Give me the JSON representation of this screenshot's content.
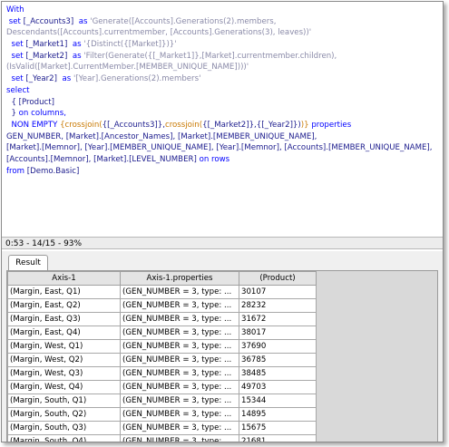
{
  "editor": {
    "lines": [
      [
        {
          "t": "With",
          "c": "kw"
        }
      ],
      [
        {
          "t": " set ",
          "c": "kw"
        },
        {
          "t": "[_Accounts3]",
          "c": "id"
        },
        {
          "t": "  as ",
          "c": "kw"
        },
        {
          "t": "'Generate([Accounts].Generations(2).members,",
          "c": "str"
        }
      ],
      [
        {
          "t": "Descendants([Accounts].currentmember, [Accounts].Generations(3), leaves))'",
          "c": "str"
        }
      ],
      [
        {
          "t": "  set ",
          "c": "kw"
        },
        {
          "t": "[_Market1]",
          "c": "id"
        },
        {
          "t": "  as ",
          "c": "kw"
        },
        {
          "t": "'{Distinct({[Market]})}'",
          "c": "str"
        }
      ],
      [
        {
          "t": "  set ",
          "c": "kw"
        },
        {
          "t": "[_Market2]",
          "c": "id"
        },
        {
          "t": "  as ",
          "c": "kw"
        },
        {
          "t": "'Filter(Generate({[_Market1]},[Market].currentmember.children),",
          "c": "str"
        }
      ],
      [
        {
          "t": "(IsValid([Market].CurrentMember.[MEMBER_UNIQUE_NAME])))'",
          "c": "str"
        }
      ],
      [
        {
          "t": "  set ",
          "c": "kw"
        },
        {
          "t": "[_Year2]",
          "c": "id"
        },
        {
          "t": "  as ",
          "c": "kw"
        },
        {
          "t": "'[Year].Generations(2).members'",
          "c": "str"
        }
      ],
      [
        {
          "t": "select",
          "c": "kw"
        }
      ],
      [
        {
          "t": "  { [Product]",
          "c": "id"
        }
      ],
      [
        {
          "t": "  } ",
          "c": "id"
        },
        {
          "t": "on columns,",
          "c": "kw"
        }
      ],
      [
        {
          "t": "  NON EMPTY ",
          "c": "kw"
        },
        {
          "t": "{crossjoin(",
          "c": "fn"
        },
        {
          "t": "{[_Accounts3]},",
          "c": "id"
        },
        {
          "t": "crossjoin(",
          "c": "fn"
        },
        {
          "t": "{[_Market2]},{[_Year2]})",
          "c": "id"
        },
        {
          "t": ")} ",
          "c": "fn"
        },
        {
          "t": "properties",
          "c": "kw"
        }
      ],
      [
        {
          "t": "GEN_NUMBER, [Market].[Ancestor_Names], [Market].[MEMBER_UNIQUE_NAME],",
          "c": "id"
        }
      ],
      [
        {
          "t": "[Market].[Memnor], [Year].[MEMBER_UNIQUE_NAME], [Year].[Memnor], [Accounts].[MEMBER_UNIQUE_NAME],",
          "c": "id"
        }
      ],
      [
        {
          "t": "[Accounts].[Memnor], [Market].[LEVEL_NUMBER] ",
          "c": "id"
        },
        {
          "t": "on rows",
          "c": "kw"
        }
      ],
      [
        {
          "t": "from ",
          "c": "kw"
        },
        {
          "t": "[Demo.Basic]",
          "c": "id"
        }
      ]
    ]
  },
  "status": {
    "text": "0:53 - 14/15 - 93%"
  },
  "tabs": {
    "result_label": "Result"
  },
  "grid": {
    "headers": [
      "Axis-1",
      "Axis-1.properties",
      "(Product)"
    ],
    "rows": [
      [
        "(Margin, East, Q1)",
        "(GEN_NUMBER = 3, type: ...",
        "30107"
      ],
      [
        "(Margin, East, Q2)",
        "(GEN_NUMBER = 3, type: ...",
        "28232"
      ],
      [
        "(Margin, East, Q3)",
        "(GEN_NUMBER = 3, type: ...",
        "31672"
      ],
      [
        "(Margin, East, Q4)",
        "(GEN_NUMBER = 3, type: ...",
        "38017"
      ],
      [
        "(Margin, West, Q1)",
        "(GEN_NUMBER = 3, type: ...",
        "37690"
      ],
      [
        "(Margin, West, Q2)",
        "(GEN_NUMBER = 3, type: ...",
        "36785"
      ],
      [
        "(Margin, West, Q3)",
        "(GEN_NUMBER = 3, type: ...",
        "38485"
      ],
      [
        "(Margin, West, Q4)",
        "(GEN_NUMBER = 3, type: ...",
        "49703"
      ],
      [
        "(Margin, South, Q1)",
        "(GEN_NUMBER = 3, type: ...",
        "15344"
      ],
      [
        "(Margin, South, Q2)",
        "(GEN_NUMBER = 3, type: ...",
        "14895"
      ],
      [
        "(Margin, South, Q3)",
        "(GEN_NUMBER = 3, type: ...",
        "15675"
      ],
      [
        "(Margin, South, Q4)",
        "(GEN_NUMBER = 3, type: ...",
        "21681"
      ]
    ]
  }
}
